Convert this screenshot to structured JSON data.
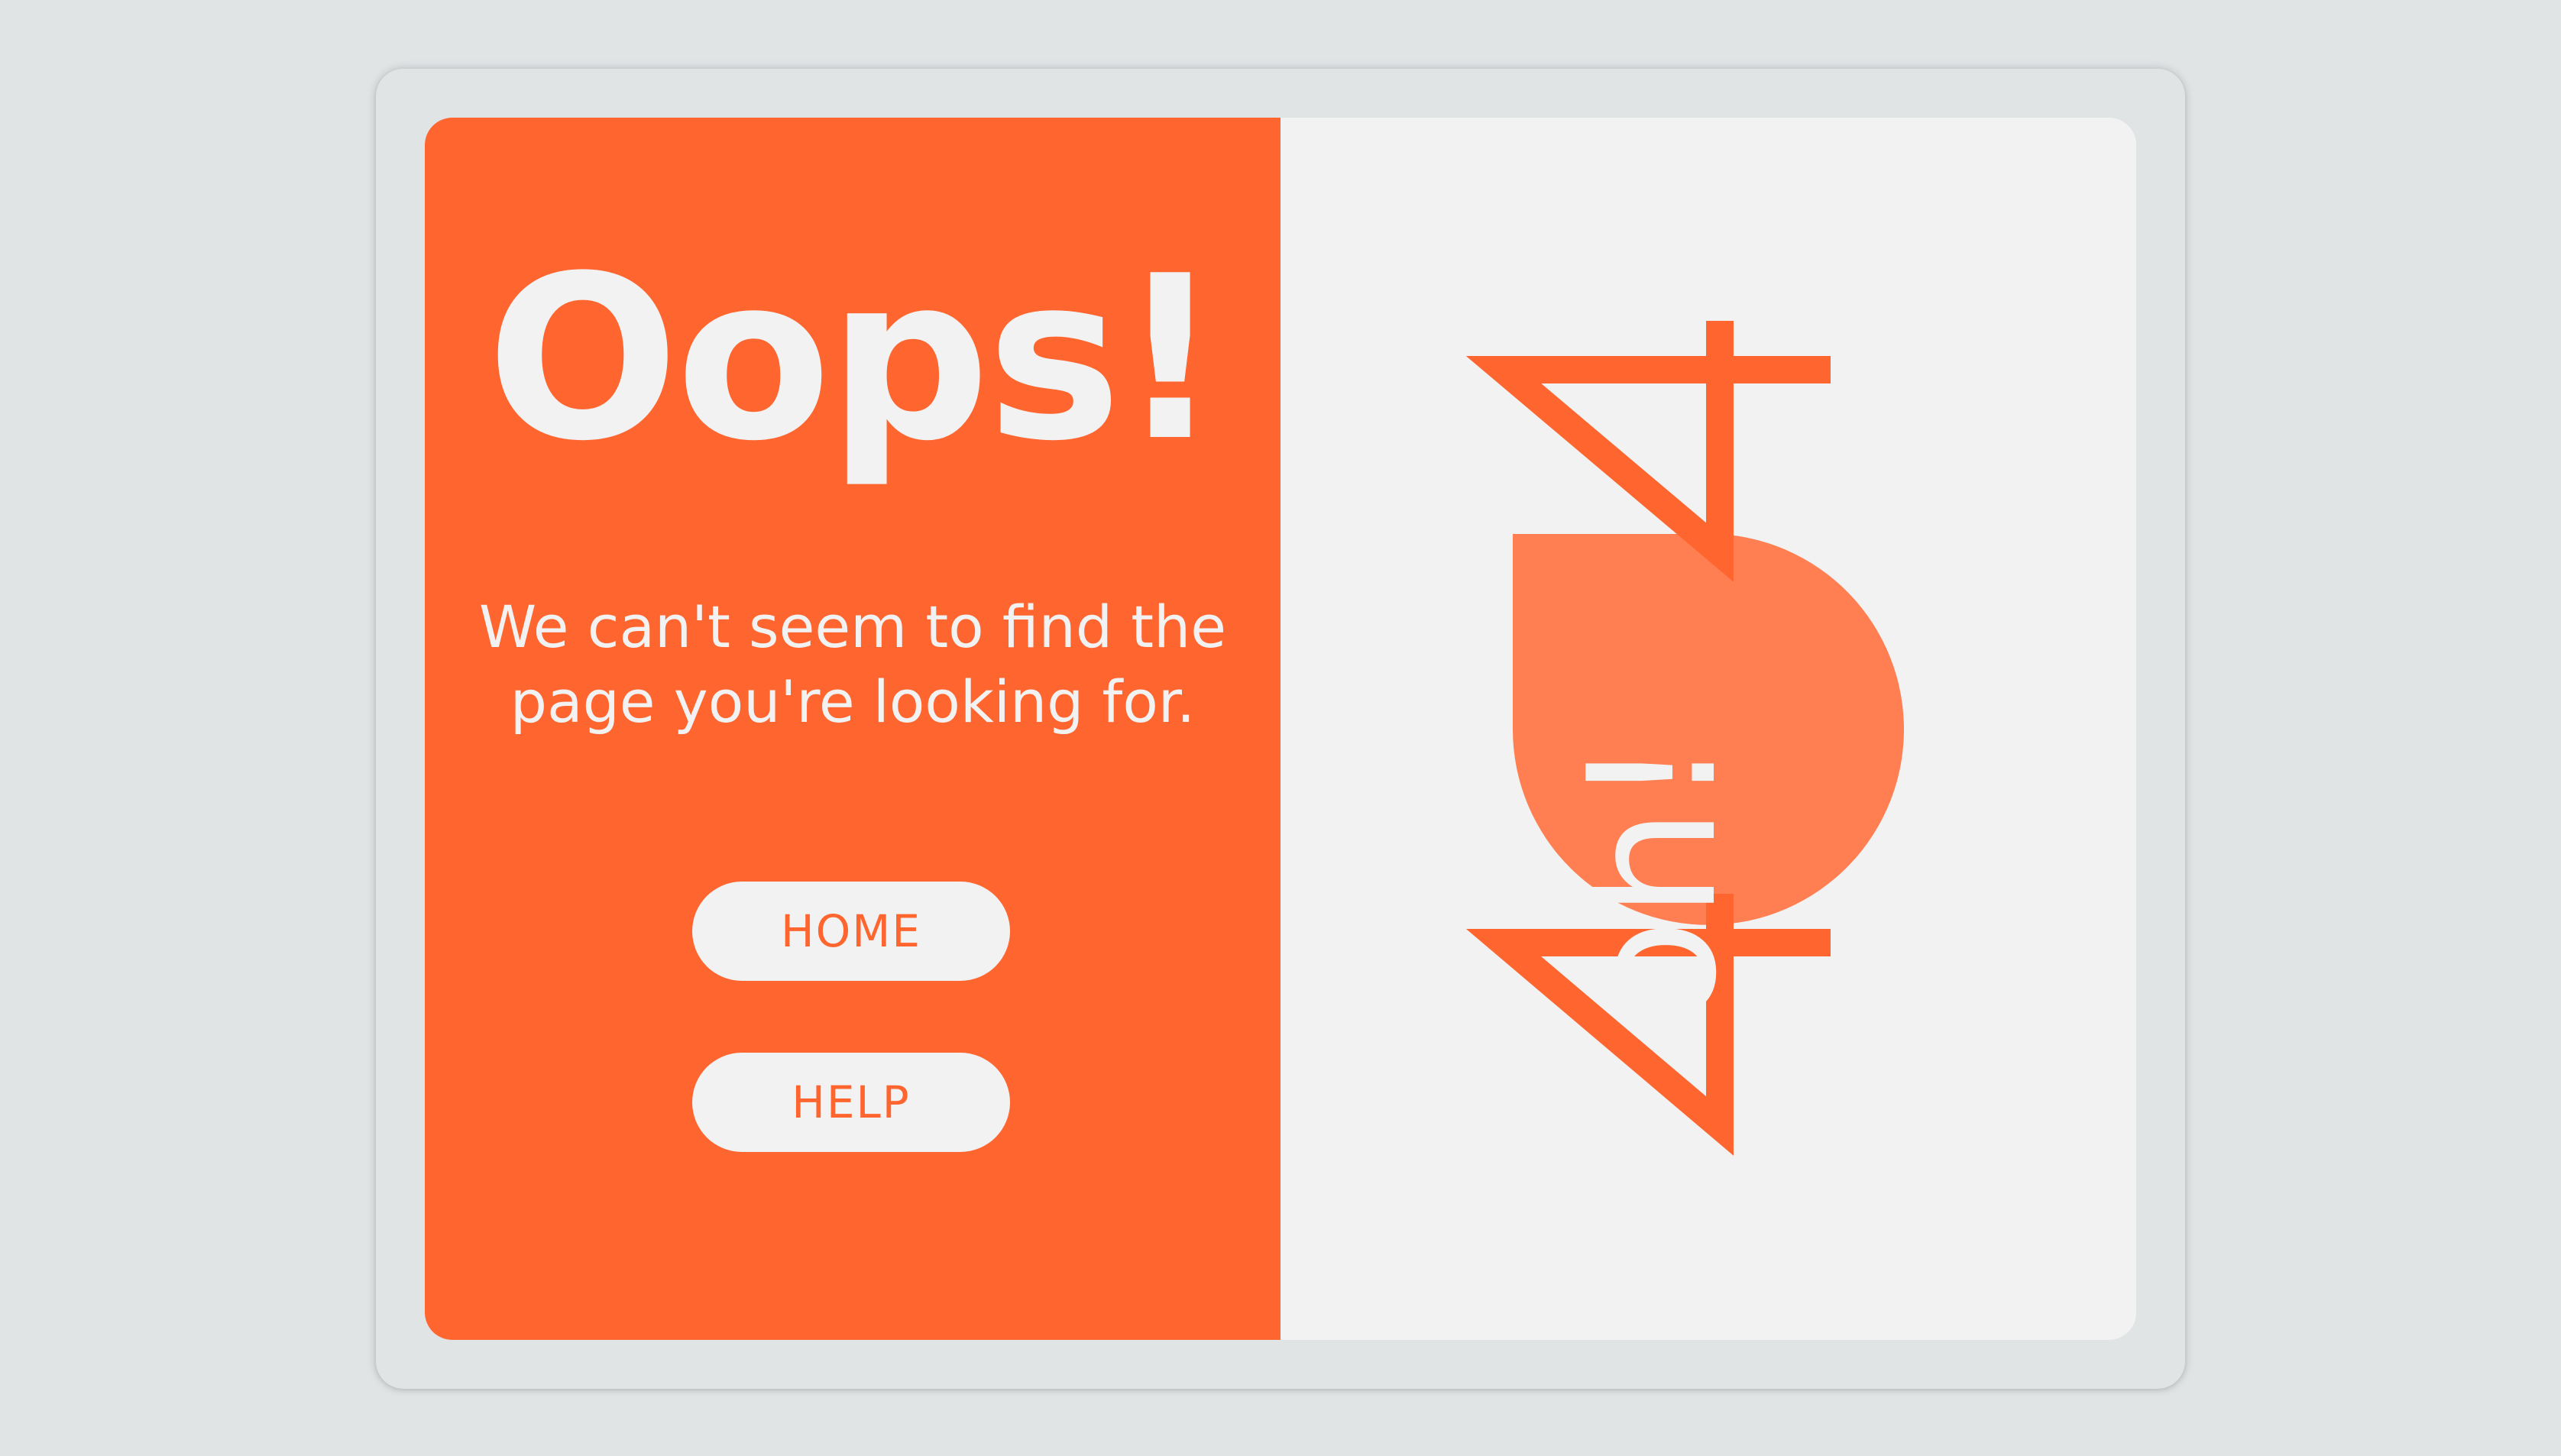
{
  "error": {
    "headline": "Oops!",
    "message": "We can't seem to find the page you're looking for."
  },
  "buttons": {
    "home_label": "HOME",
    "help_label": "HELP"
  },
  "illustration": {
    "code_digit_left": "4",
    "code_digit_right": "4",
    "bubble_text": "oh!"
  },
  "colors": {
    "accent": "#ff652f",
    "bubble": "#ff7f52",
    "light": "#f2f2f2",
    "background": "#e0e4e5"
  }
}
